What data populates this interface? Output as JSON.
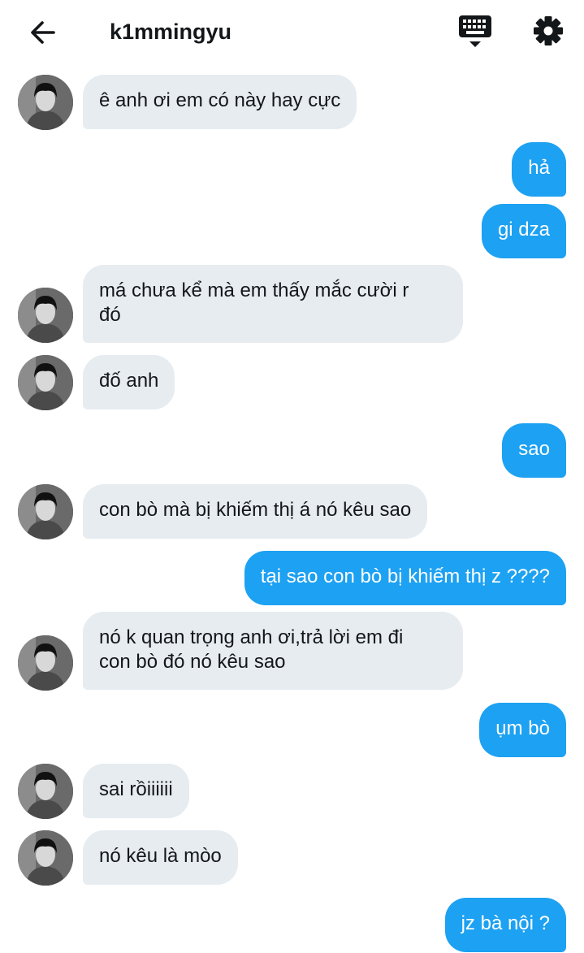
{
  "header": {
    "title": "k1mmingyu",
    "back_icon": "arrow-left-icon",
    "keyboard_icon": "keyboard-icon",
    "settings_icon": "gear-icon"
  },
  "colors": {
    "incoming_bubble": "#e6ecf0",
    "outgoing_bubble": "#1da1f2",
    "text": "#14171a"
  },
  "messages": [
    {
      "direction": "in",
      "text": "ê anh ơi em có này hay cực",
      "avatar": true
    },
    {
      "direction": "out",
      "text": "hả"
    },
    {
      "direction": "out",
      "text": "gi dza"
    },
    {
      "direction": "in",
      "text": "má chưa kể mà em thấy mắc cười r\nđó",
      "avatar": true
    },
    {
      "direction": "in",
      "text": "đố anh",
      "avatar": true
    },
    {
      "direction": "out",
      "text": "sao"
    },
    {
      "direction": "in",
      "text": "con bò mà bị khiếm thị á nó kêu sao",
      "avatar": true
    },
    {
      "direction": "out",
      "text": "tại sao con bò bị khiếm thị z ????"
    },
    {
      "direction": "in",
      "text": "nó k quan trọng anh ơi,trả lời em đi\ncon bò đó nó kêu sao",
      "avatar": true
    },
    {
      "direction": "out",
      "text": "ụm bò"
    },
    {
      "direction": "in",
      "text": "sai rồiiiiii",
      "avatar": true
    },
    {
      "direction": "in",
      "text": "nó kêu là mòo",
      "avatar": true
    },
    {
      "direction": "out",
      "text": "jz bà nội ?"
    }
  ]
}
